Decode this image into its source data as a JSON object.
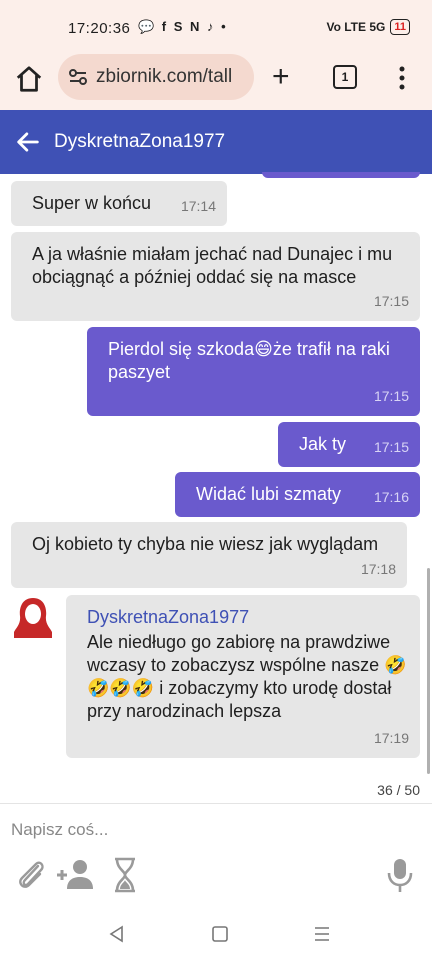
{
  "status_bar": {
    "time": "17:20:36",
    "notif_icons": "💬 f S N ♪ •",
    "network": "Vo LTE 5G",
    "battery": "11"
  },
  "browser": {
    "url": "zbiornik.com/tall",
    "tab_count": "1"
  },
  "chat": {
    "title": "DyskretnaZona1977",
    "messages": [
      {
        "dir": "in",
        "text": "Super w końcu",
        "time": "17:14"
      },
      {
        "dir": "in",
        "text": "A ja właśnie miałam jechać nad Dunajec i mu obciągnąć a później oddać się na masce",
        "time": "17:15"
      },
      {
        "dir": "out",
        "text": "Pierdol się szkoda😄że trafił na raki paszyet",
        "time": "17:15"
      },
      {
        "dir": "out",
        "text": "Jak ty",
        "time": "17:15"
      },
      {
        "dir": "out",
        "text": "Widać lubi szmaty",
        "time": "17:16"
      },
      {
        "dir": "in",
        "text": "Oj kobieto ty chyba nie wiesz jak wyglądam",
        "time": "17:18"
      },
      {
        "dir": "in",
        "sender": "DyskretnaZona1977",
        "text": "Ale niedługo go zabiorę na prawdziwe wczasy to zobaczysz wspólne nasze 🤣🤣🤣🤣 i zobaczymy kto urodę dostał przy narodzinach lepsza",
        "time": "17:19"
      }
    ],
    "counter": "36 / 50"
  },
  "composer": {
    "placeholder": "Napisz coś..."
  },
  "colors": {
    "header": "#3f51b5",
    "outgoing": "#6a5acd",
    "incoming": "#e6e6e6",
    "browser_bar": "#fcefea"
  },
  "icons": [
    "home-icon",
    "site-settings-icon",
    "plus-icon",
    "tab-count-icon",
    "menu-dots-icon",
    "back-arrow-icon",
    "avatar-icon",
    "paperclip-icon",
    "add-user-icon",
    "hourglass-icon",
    "microphone-icon",
    "nav-back-icon",
    "nav-home-icon",
    "nav-recents-icon"
  ]
}
